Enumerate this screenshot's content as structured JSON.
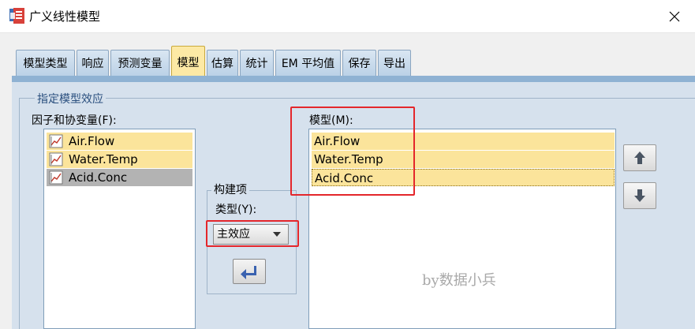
{
  "window": {
    "title": "广义线性模型"
  },
  "tabs": [
    {
      "label": "模型类型",
      "active": false
    },
    {
      "label": "响应",
      "active": false
    },
    {
      "label": "预测变量",
      "active": false
    },
    {
      "label": "模型",
      "active": true
    },
    {
      "label": "估算",
      "active": false
    },
    {
      "label": "统计",
      "active": false
    },
    {
      "label": "EM 平均值",
      "active": false
    },
    {
      "label": "保存",
      "active": false
    },
    {
      "label": "导出",
      "active": false
    }
  ],
  "model_effects": {
    "group_title": "指定模型效应",
    "factors_label": "因子和协变量(F):",
    "factors": [
      "Air.Flow",
      "Water.Temp",
      "Acid.Conc"
    ],
    "model_label": "模型(M):",
    "model_terms": [
      "Air.Flow",
      "Water.Temp",
      "Acid.Conc"
    ],
    "build_term": {
      "group_title": "构建项",
      "type_label": "类型(Y):",
      "type_value": "主效应"
    }
  },
  "watermark": "by数据小兵",
  "colors": {
    "selection": "#fbe49b",
    "highlight_box": "#e4262b",
    "active_tab": "#fde9a5"
  }
}
